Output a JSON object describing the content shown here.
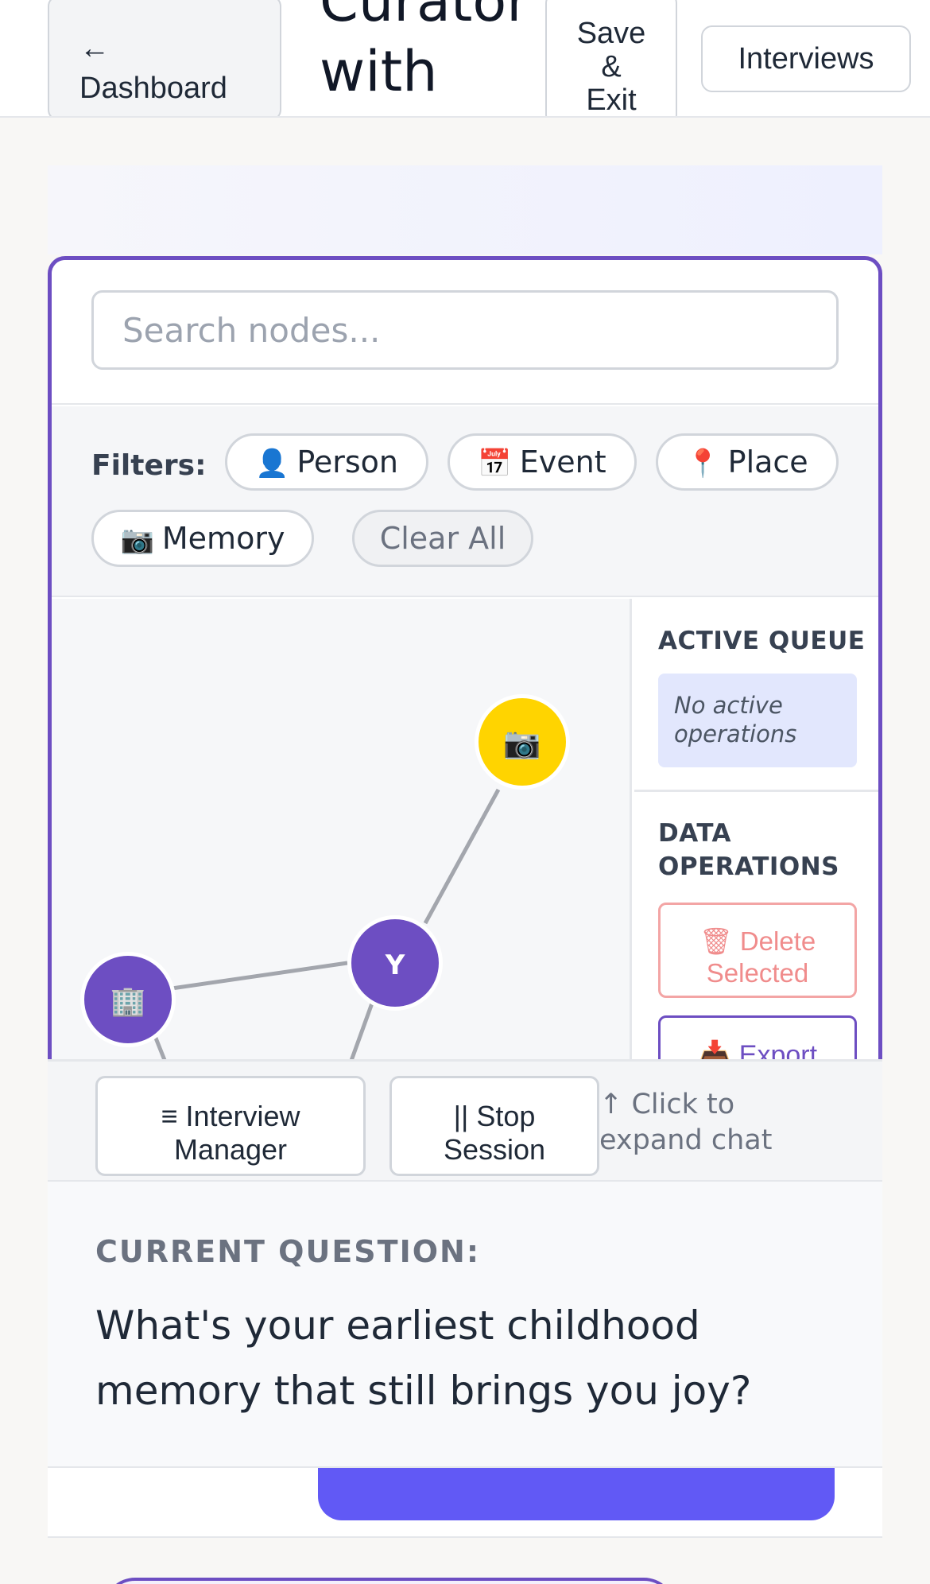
{
  "header": {
    "back_arrow": "←",
    "back_label": "Dashboard",
    "title": "Curator with Winston",
    "save_line1": "Save",
    "save_line2": "&",
    "save_line3": "Exit",
    "interviews_label": "Interviews"
  },
  "search": {
    "placeholder": "Search nodes...",
    "value": ""
  },
  "filters": {
    "label": "Filters:",
    "chips": [
      {
        "icon": "👤",
        "label": "Person"
      },
      {
        "icon": "📅",
        "label": "Event"
      },
      {
        "icon": "📍",
        "label": "Place"
      },
      {
        "icon": "📷",
        "label": "Memory"
      }
    ],
    "clear_label": "Clear All"
  },
  "graph": {
    "nodes": [
      {
        "id": "memory-node",
        "icon": "📷",
        "color": "#ffd400"
      },
      {
        "id": "person-node",
        "label": "Y",
        "color": "#6d4ec2"
      },
      {
        "id": "place-node",
        "icon": "🏢",
        "color": "#6d4ec2"
      }
    ],
    "edge_color": "#a3a6ad"
  },
  "side_panel": {
    "queue_title": "ACTIVE QUEUE",
    "queue_empty": "No active operations",
    "ops_title_line1": "DATA",
    "ops_title_line2": "OPERATIONS",
    "delete_icon": "🗑",
    "delete_line1": "Delete",
    "delete_line2": "Selected",
    "export_icon": "📥",
    "export_label": "Export"
  },
  "controls": {
    "manager_icon": "≡",
    "manager_line1": "Interview",
    "manager_line2": "Manager",
    "stop_icon": "||",
    "stop_line1": "Stop",
    "stop_line2": "Session",
    "expand_hint_line1": "↑ Click to",
    "expand_hint_line2": "expand chat"
  },
  "question": {
    "label": "CURRENT QUESTION:",
    "text": "What's your earliest childhood memory that still brings you joy?"
  },
  "colors": {
    "accent": "#6d4ec2",
    "primary_button": "#6159f5",
    "memory_node": "#ffd400",
    "danger": "#f08c8c"
  }
}
